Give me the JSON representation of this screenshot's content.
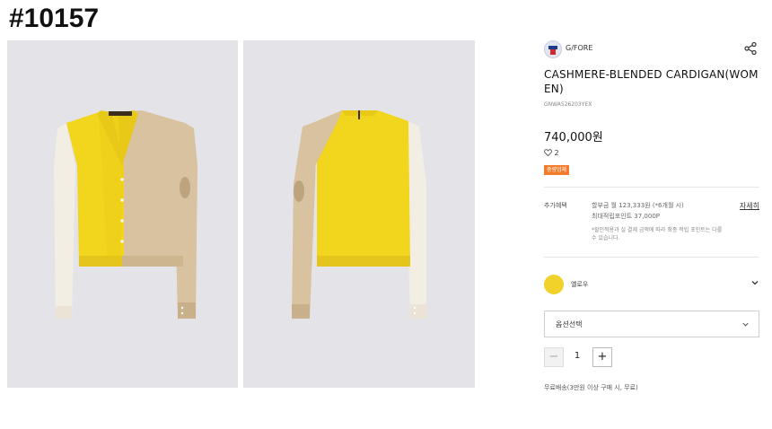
{
  "tag": "#10157",
  "product": {
    "brand": "G/FORE",
    "title": "CASHMERE-BLENDED CARDIGAN(WOMEN)",
    "code": "GNWA526203YEX",
    "price": "740,000원",
    "likes": "2",
    "badge": "중량업체"
  },
  "benefits": {
    "label": "추가혜택",
    "line1": "할부금 월 123,333원 (*6개월 시)",
    "line2": "최대적립포인트 37,000P",
    "note": "*할인적용과 실 결제 금액에 따라 최종 적립 포인트는 다를 수 있습니다.",
    "detail_link": "자세히"
  },
  "color_option": {
    "name": "옐로우",
    "swatch": "#f0d22b"
  },
  "option_select": {
    "label": "옵션선택"
  },
  "quantity": {
    "value": "1",
    "minus": "−",
    "plus": "+"
  },
  "shipping": "무료배송(3만원 이상 구매 시, 무료)",
  "icons": [
    "share-icon",
    "heart-icon",
    "chevron-down-icon"
  ],
  "colors": {
    "photo_bg": "#e4e3e8",
    "yellow": "#f2d51d",
    "beige": "#d8c2a0",
    "cream": "#f3eee3",
    "badge": "#f47b2a"
  }
}
